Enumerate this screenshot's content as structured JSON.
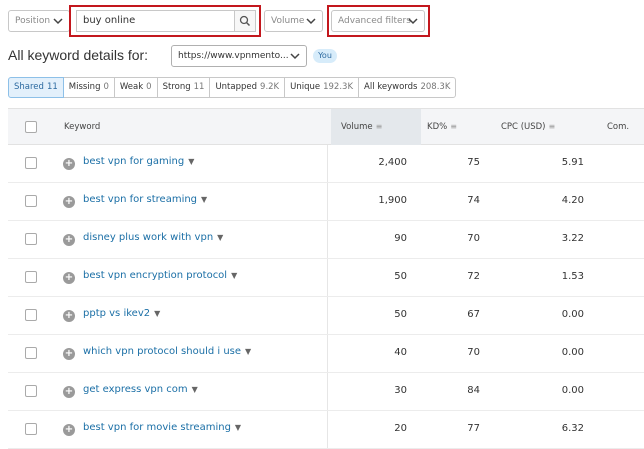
{
  "filters": {
    "position_label": "Position",
    "search_value": "buy online",
    "volume_label": "Volume",
    "advanced_label": "Advanced filters"
  },
  "heading": {
    "title": "All keyword details for:",
    "domain_value": "https://www.vpnmento...",
    "you_badge": "You"
  },
  "tabs": [
    {
      "label": "Shared",
      "count": "11",
      "active": true
    },
    {
      "label": "Missing",
      "count": "0"
    },
    {
      "label": "Weak",
      "count": "0"
    },
    {
      "label": "Strong",
      "count": "11"
    },
    {
      "label": "Untapped",
      "count": "9.2K"
    },
    {
      "label": "Unique",
      "count": "192.3K"
    },
    {
      "label": "All keywords",
      "count": "208.3K"
    }
  ],
  "table": {
    "headers": {
      "keyword": "Keyword",
      "volume": "Volume",
      "kd": "KD%",
      "cpc": "CPC (USD)",
      "com": "Com."
    },
    "rows": [
      {
        "keyword": "best vpn for gaming",
        "volume": "2,400",
        "kd": "75",
        "cpc": "5.91"
      },
      {
        "keyword": "best vpn for streaming",
        "volume": "1,900",
        "kd": "74",
        "cpc": "4.20"
      },
      {
        "keyword": "disney plus work with vpn",
        "volume": "90",
        "kd": "70",
        "cpc": "3.22"
      },
      {
        "keyword": "best vpn encryption protocol",
        "volume": "50",
        "kd": "72",
        "cpc": "1.53"
      },
      {
        "keyword": "pptp vs ikev2",
        "volume": "50",
        "kd": "67",
        "cpc": "0.00"
      },
      {
        "keyword": "which vpn protocol should i use",
        "volume": "40",
        "kd": "70",
        "cpc": "0.00"
      },
      {
        "keyword": "get express vpn com",
        "volume": "30",
        "kd": "84",
        "cpc": "0.00"
      },
      {
        "keyword": "best vpn for movie streaming",
        "volume": "20",
        "kd": "77",
        "cpc": "6.32"
      }
    ]
  },
  "colors": {
    "highlight_border": "#c3171d",
    "link": "#1b6fa6",
    "active_tab_bg": "#e3f0fb"
  }
}
